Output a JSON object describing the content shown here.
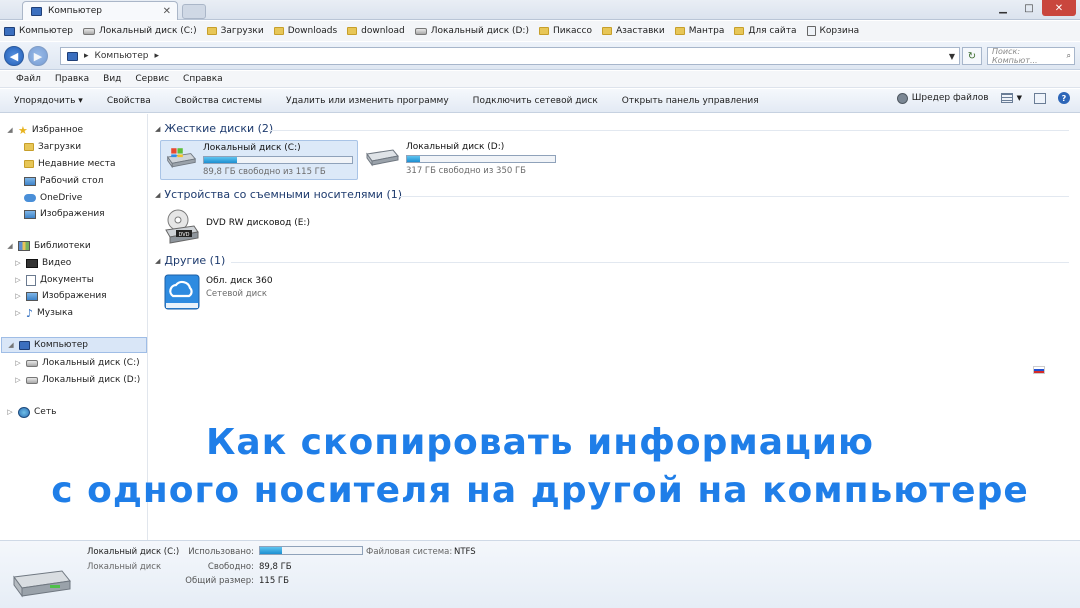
{
  "window": {
    "tab_title": "Компьютер",
    "accent": "#1f7ee8"
  },
  "bookmarks": [
    {
      "label": "Компьютер",
      "icon": "computer-icon"
    },
    {
      "label": "Локальный диск (C:)",
      "icon": "drive-icon"
    },
    {
      "label": "Загрузки",
      "icon": "folder-icon"
    },
    {
      "label": "Downloads",
      "icon": "folder-icon"
    },
    {
      "label": "download",
      "icon": "folder-icon"
    },
    {
      "label": "Локальный диск (D:)",
      "icon": "drive-icon"
    },
    {
      "label": "Пикассо",
      "icon": "folder-icon"
    },
    {
      "label": "Азаставки",
      "icon": "folder-icon"
    },
    {
      "label": "Мантра",
      "icon": "folder-icon"
    },
    {
      "label": "Для сайта",
      "icon": "folder-icon"
    },
    {
      "label": "Корзина",
      "icon": "trash-icon"
    }
  ],
  "address": {
    "path": "Компьютер",
    "separator": "▸",
    "search_placeholder": "Поиск: Компьют..."
  },
  "menu": [
    "Файл",
    "Правка",
    "Вид",
    "Сервис",
    "Справка"
  ],
  "toolbar": {
    "items": [
      "Упорядочить ▾",
      "Свойства",
      "Свойства системы",
      "Удалить или изменить программу",
      "Подключить сетевой диск",
      "Открыть панель управления"
    ],
    "shredder": "Шредер файлов"
  },
  "sidebar": {
    "favorites": "Избранное",
    "favorites_items": [
      "Загрузки",
      "Недавние места",
      "Рабочий стол",
      "OneDrive",
      "Изображения"
    ],
    "libraries": "Библиотеки",
    "libraries_items": [
      "Видео",
      "Документы",
      "Изображения",
      "Музыка"
    ],
    "computer": "Компьютер",
    "computer_items": [
      "Локальный диск (C:)",
      "Локальный диск (D:)"
    ],
    "network": "Сеть"
  },
  "groups": {
    "hard_drives": "Жесткие диски (2)",
    "removable": "Устройства со съемными носителями (1)",
    "other": "Другие (1)"
  },
  "drives": [
    {
      "name": "Локальный диск (C:)",
      "free": "89,8 ГБ свободно из 115 ГБ",
      "used_fraction": 0.22
    },
    {
      "name": "Локальный диск (D:)",
      "free": "317 ГБ свободно из 350 ГБ",
      "used_fraction": 0.09
    }
  ],
  "removable_items": [
    {
      "name": "DVD RW дисковод (E:)",
      "badge": "DVD"
    }
  ],
  "other_items": [
    {
      "name": "Обл. диск 360",
      "sub": "Сетевой диск"
    }
  ],
  "overlay": {
    "line1": "Как скопировать информацию",
    "line2": "с одного носителя на другой на компьютере"
  },
  "details": {
    "name": "Локальный диск (C:)",
    "type": "Локальный диск",
    "used_label": "Использовано:",
    "used_fraction": 0.22,
    "fs_label": "Файловая система:",
    "fs_value": "NTFS",
    "free_label": "Свободно:",
    "free_value": "89,8 ГБ",
    "total_label": "Общий размер:",
    "total_value": "115 ГБ"
  }
}
